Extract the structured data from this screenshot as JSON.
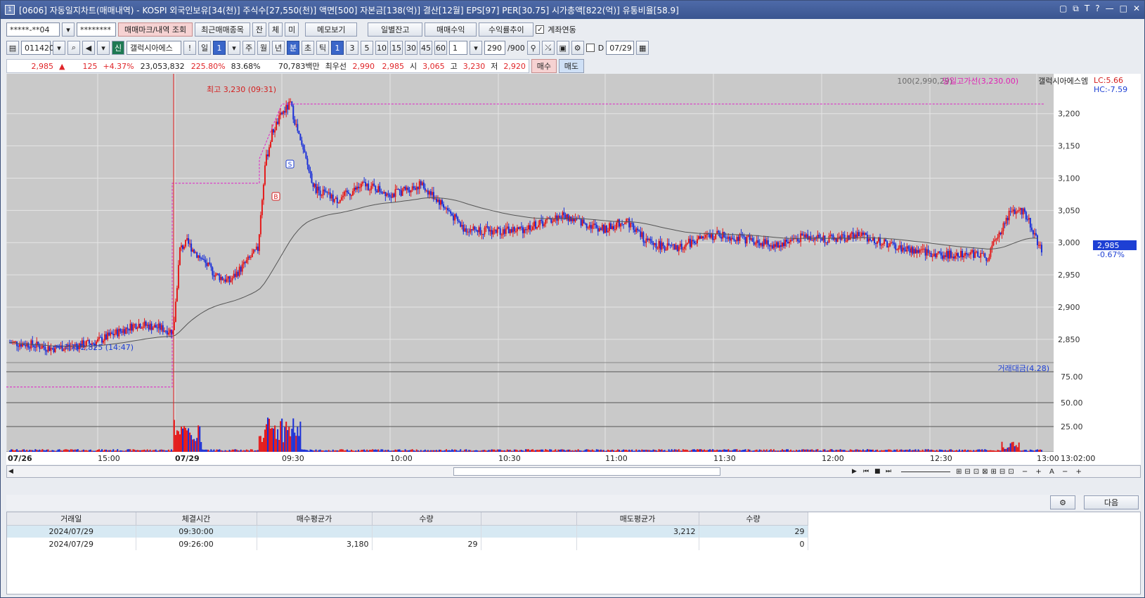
{
  "window": {
    "icon_label": "1",
    "title": "[0606] 자동일지차트(매매내역) - KOSPI 외국인보유[34(천)] 주식수[27,550(천)] 액면[500] 자본금[138(억)] 결산[12월] EPS[97] PER[30.75] 시가총액[822(억)] 유통비율[58.9]",
    "controls": [
      "▢",
      "⧉",
      "T",
      "?",
      "—",
      "□",
      "✕"
    ]
  },
  "toolbar1": {
    "account": "*****-**04",
    "password": "********",
    "btn_trade_marks": "매매마크/내역 조회",
    "btn_recent": "최근매매종목",
    "btn_jan": "잔",
    "btn_che": "체",
    "btn_mi": "미",
    "btn_memo": "메모보기",
    "btn_daily": "일별잔고",
    "btn_profit": "매매수익",
    "btn_return": "수익률추이",
    "chk_account_link": "계좌연동"
  },
  "toolbar2": {
    "code": "011420",
    "stock_name": "갤럭시아에스",
    "sin": "신",
    "excl": "!",
    "periods": [
      "일",
      "1",
      "주",
      "월",
      "년",
      "분",
      "초",
      "틱"
    ],
    "minutes": [
      "1",
      "3",
      "5",
      "10",
      "15",
      "30",
      "45",
      "60"
    ],
    "count": "1",
    "range": "290",
    "range_max": "/900",
    "chk_d": "D",
    "date": "07/29"
  },
  "quote": {
    "price": "2,985",
    "change": "125",
    "change_pct": "+4.37%",
    "volume": "23,053,832",
    "vol_ratio": "225.80%",
    "ratio2": "83.68%",
    "amount": "70,783백만",
    "best_label": "최우선",
    "best1": "2,990",
    "best2": "2,985",
    "open_label": "시",
    "open": "3,065",
    "high_label": "고",
    "high": "3,230",
    "low_label": "저",
    "low": "2,920",
    "buy": "매수",
    "sell": "매도"
  },
  "chart_data": {
    "type": "candlestick",
    "legend": {
      "ma": "100(2,990,29)",
      "high_line": "당일고가선(3,230.00)",
      "name": "갤럭시아에스엠",
      "lc": "LC:5.66",
      "hc": "HC:-7.59"
    },
    "annotations": {
      "high": "최고 3,230 (09:31)",
      "low": "최저 2,825 (14:47)",
      "buy_mark": "B",
      "sell_mark": "S",
      "current_price": "2,985",
      "current_pct": "-0.67%"
    },
    "price_axis": [
      "3,200",
      "3,150",
      "3,100",
      "3,050",
      "3,000",
      "2,950",
      "2,900",
      "2,850"
    ],
    "ylim": [
      2815,
      3240
    ],
    "volume_legend": "거래대금(4.28)",
    "volume_axis": [
      "75.00",
      "50.00",
      "25.00"
    ],
    "time_axis": [
      "07/26",
      "15:00",
      "07/29",
      "09:30",
      "10:00",
      "10:30",
      "11:00",
      "11:30",
      "12:00",
      "12:30",
      "13:00",
      "13:02:00"
    ],
    "prev_close": 2860,
    "today_high": 3230,
    "anchors": [
      [
        0,
        2845
      ],
      [
        15,
        2842
      ],
      [
        30,
        2836
      ],
      [
        45,
        2840
      ],
      [
        60,
        2845
      ],
      [
        75,
        2860
      ],
      [
        90,
        2874
      ],
      [
        105,
        2868
      ],
      [
        115,
        2862
      ],
      [
        116,
        2880
      ],
      [
        120,
        2990
      ],
      [
        125,
        3000
      ],
      [
        135,
        2975
      ],
      [
        145,
        2950
      ],
      [
        155,
        2940
      ],
      [
        165,
        2965
      ],
      [
        175,
        2990
      ],
      [
        180,
        3120
      ],
      [
        185,
        3170
      ],
      [
        192,
        3200
      ],
      [
        198,
        3215
      ],
      [
        205,
        3155
      ],
      [
        215,
        3085
      ],
      [
        230,
        3065
      ],
      [
        250,
        3090
      ],
      [
        270,
        3075
      ],
      [
        290,
        3090
      ],
      [
        305,
        3060
      ],
      [
        320,
        3022
      ],
      [
        340,
        3018
      ],
      [
        360,
        3020
      ],
      [
        375,
        3030
      ],
      [
        390,
        3042
      ],
      [
        405,
        3030
      ],
      [
        420,
        3020
      ],
      [
        435,
        3035
      ],
      [
        450,
        3000
      ],
      [
        470,
        2990
      ],
      [
        485,
        3005
      ],
      [
        500,
        3012
      ],
      [
        520,
        3005
      ],
      [
        540,
        2995
      ],
      [
        560,
        3010
      ],
      [
        580,
        3005
      ],
      [
        600,
        3012
      ],
      [
        615,
        3000
      ],
      [
        630,
        2990
      ],
      [
        645,
        2985
      ],
      [
        660,
        2980
      ],
      [
        675,
        2985
      ],
      [
        690,
        2978
      ],
      [
        705,
        3045
      ],
      [
        715,
        3050
      ],
      [
        720,
        3030
      ],
      [
        728,
        2985
      ]
    ]
  },
  "trade_table": {
    "settings_icon": "gear-icon",
    "next": "다음",
    "columns": [
      "거래일",
      "체결시간",
      "매수평균가",
      "수량",
      "",
      "매도평균가",
      "수량"
    ],
    "rows": [
      [
        "2024/07/29",
        "09:30:00",
        "",
        "",
        "",
        "3,212",
        "29"
      ],
      [
        "2024/07/29",
        "09:26:00",
        "3,180",
        "29",
        "",
        "",
        "0"
      ]
    ]
  }
}
